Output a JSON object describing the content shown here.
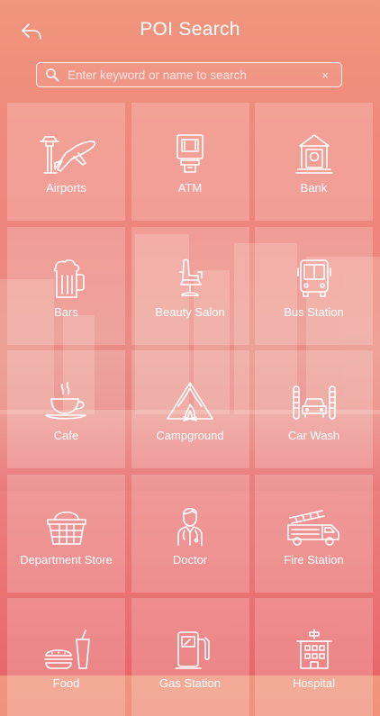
{
  "header": {
    "title": "POI Search",
    "back_icon": "back-arrow-icon"
  },
  "search": {
    "placeholder": "Enter keyword or name to search",
    "value": "",
    "search_icon": "search-icon",
    "clear_icon": "close-icon",
    "clear_glyph": "×"
  },
  "categories": [
    {
      "label": "Airports",
      "icon": "airport-icon"
    },
    {
      "label": "ATM",
      "icon": "atm-icon"
    },
    {
      "label": "Bank",
      "icon": "bank-icon"
    },
    {
      "label": "Bars",
      "icon": "beer-mug-icon"
    },
    {
      "label": "Beauty Salon",
      "icon": "salon-chair-icon"
    },
    {
      "label": "Bus Station",
      "icon": "bus-icon"
    },
    {
      "label": "Cafe",
      "icon": "coffee-cup-icon"
    },
    {
      "label": "Campground",
      "icon": "tent-icon"
    },
    {
      "label": "Car Wash",
      "icon": "car-wash-icon"
    },
    {
      "label": "Department Store",
      "icon": "shopping-basket-icon"
    },
    {
      "label": "Doctor",
      "icon": "doctor-icon"
    },
    {
      "label": "Fire Station",
      "icon": "fire-truck-icon"
    },
    {
      "label": "Food",
      "icon": "food-icon"
    },
    {
      "label": "Gas Station",
      "icon": "gas-pump-icon"
    },
    {
      "label": "Hospital",
      "icon": "hospital-icon"
    }
  ]
}
